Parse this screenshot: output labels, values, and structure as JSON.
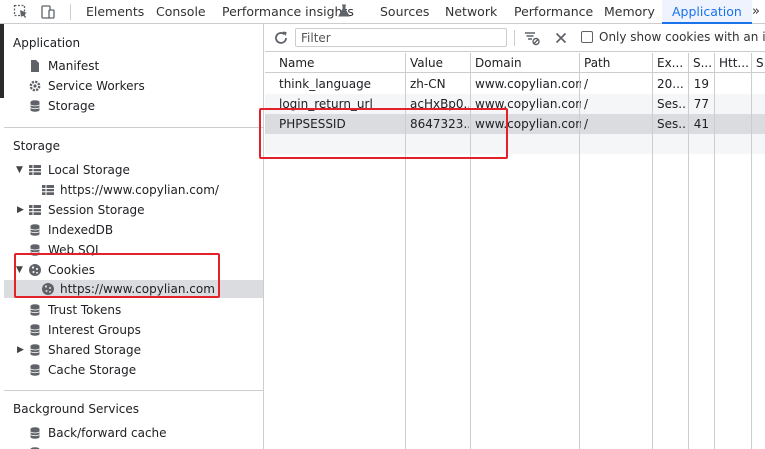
{
  "tabbar": {
    "tabs": [
      {
        "label": "Elements"
      },
      {
        "label": "Console"
      },
      {
        "label": "Performance insights"
      },
      {
        "label": "Sources"
      },
      {
        "label": "Network"
      },
      {
        "label": "Performance"
      },
      {
        "label": "Memory"
      },
      {
        "label": "Application"
      }
    ],
    "overflow": "»",
    "active_tab": "Application"
  },
  "sidebar": {
    "application": {
      "title": "Application",
      "items": [
        {
          "label": "Manifest",
          "icon": "file-icon"
        },
        {
          "label": "Service Workers",
          "icon": "gear-icon"
        },
        {
          "label": "Storage",
          "icon": "database-icon"
        }
      ]
    },
    "storage": {
      "title": "Storage",
      "local_storage": {
        "label": "Local Storage",
        "child": "https://www.copylian.com/"
      },
      "session_storage": {
        "label": "Session Storage"
      },
      "indexeddb": {
        "label": "IndexedDB"
      },
      "websql": {
        "label": "Web SQL"
      },
      "cookies": {
        "label": "Cookies",
        "child": "https://www.copylian.com"
      },
      "trust_tokens": {
        "label": "Trust Tokens"
      },
      "interest_groups": {
        "label": "Interest Groups"
      },
      "shared_storage": {
        "label": "Shared Storage"
      },
      "cache_storage": {
        "label": "Cache Storage"
      }
    },
    "background": {
      "title": "Background Services",
      "bfcache": {
        "label": "Back/forward cache"
      }
    }
  },
  "toolbar": {
    "filter_placeholder": "Filter",
    "only_issues_label": "Only show cookies with an issue"
  },
  "cookies_table": {
    "headers": {
      "name": "Name",
      "value": "Value",
      "domain": "Domain",
      "path": "Path",
      "expires": "Ex...",
      "size": "S...",
      "httponly": "Htt...",
      "secure": "S..."
    },
    "rows": [
      {
        "name": "think_language",
        "value": "zh-CN",
        "domain": "www.copylian.com",
        "path": "/",
        "expires": "20...",
        "size": "19"
      },
      {
        "name": "login_return_url",
        "value": "acHxBp0...",
        "domain": "www.copylian.com",
        "path": "/",
        "expires": "Ses...",
        "size": "77"
      },
      {
        "name": "PHPSESSID",
        "value": "8647323...",
        "domain": "www.copylian.com",
        "path": "/",
        "expires": "Ses...",
        "size": "41"
      }
    ]
  },
  "colors": {
    "accent": "#1a73e8",
    "highlight": "#e32128",
    "selection": "#dadce0"
  }
}
